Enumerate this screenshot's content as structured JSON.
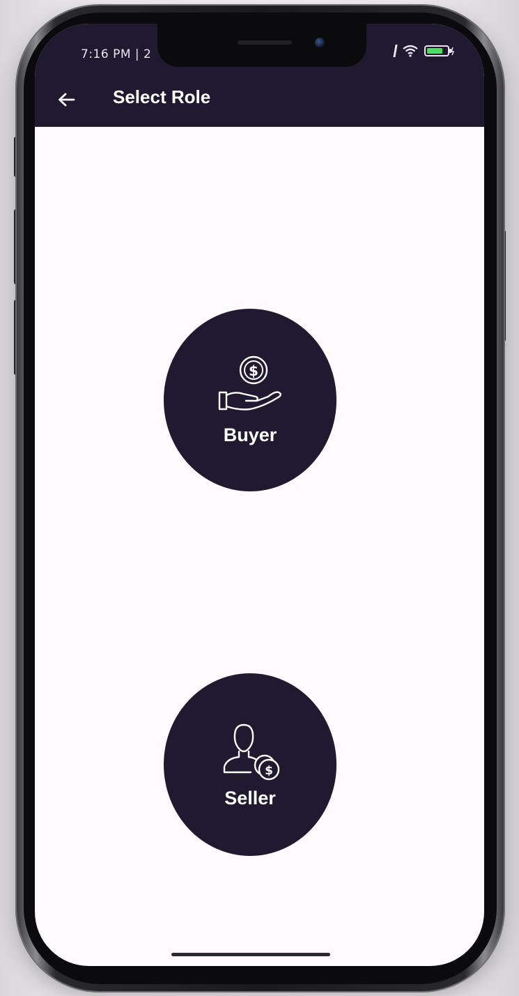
{
  "status_bar": {
    "time": "7:16 PM | 2"
  },
  "header": {
    "title": "Select Role",
    "back_icon": "arrow-left-icon"
  },
  "roles": [
    {
      "label": "Buyer",
      "icon": "hand-dollar-icon"
    },
    {
      "label": "Seller",
      "icon": "person-coins-icon"
    }
  ],
  "colors": {
    "primary": "#1f1a30",
    "background": "#fdfbfd",
    "text_on_primary": "#ffffff",
    "battery": "#4cd964"
  }
}
